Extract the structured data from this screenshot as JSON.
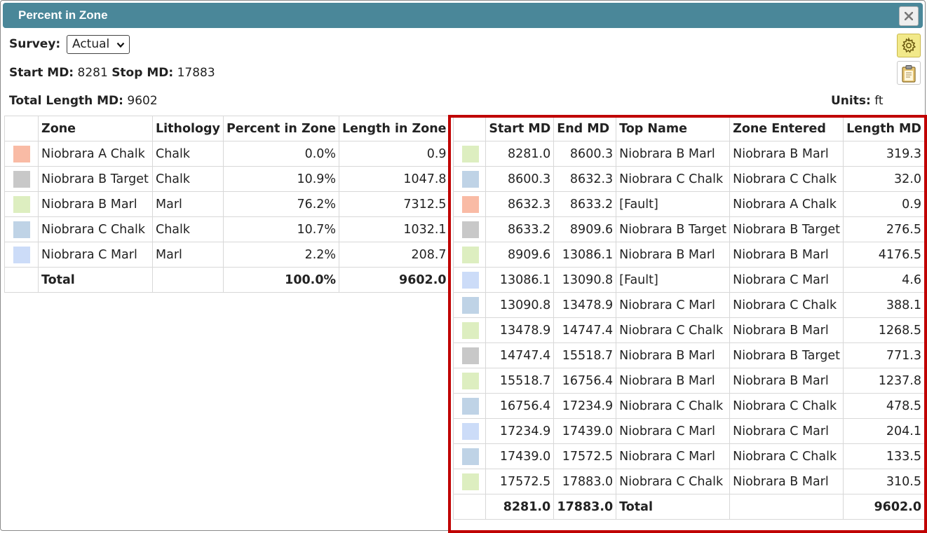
{
  "window": {
    "title": "Percent in Zone"
  },
  "survey": {
    "label": "Survey:",
    "value": "Actual"
  },
  "md_info": {
    "start_label": "Start MD:",
    "start_value": "8281",
    "stop_label": "Stop MD:",
    "stop_value": "17883",
    "total_label": "Total Length MD:",
    "total_value": "9602",
    "units_label": "Units:",
    "units_value": "ft"
  },
  "zone_table": {
    "headers": [
      "Zone",
      "Lithology",
      "Percent in Zone",
      "Length in Zone"
    ],
    "rows": [
      {
        "color": "#f9bba5",
        "zone": "Niobrara A Chalk",
        "lithology": "Chalk",
        "percent": "0.0%",
        "length": "0.9"
      },
      {
        "color": "#c8c8c8",
        "zone": "Niobrara B Target",
        "lithology": "Chalk",
        "percent": "10.9%",
        "length": "1047.8"
      },
      {
        "color": "#ddeec0",
        "zone": "Niobrara B Marl",
        "lithology": "Marl",
        "percent": "76.2%",
        "length": "7312.5"
      },
      {
        "color": "#bfd3e6",
        "zone": "Niobrara C Chalk",
        "lithology": "Chalk",
        "percent": "10.7%",
        "length": "1032.1"
      },
      {
        "color": "#ccdcf8",
        "zone": "Niobrara C Marl",
        "lithology": "Marl",
        "percent": "2.2%",
        "length": "208.7"
      }
    ],
    "total": {
      "label": "Total",
      "percent": "100.0%",
      "length": "9602.0"
    }
  },
  "interval_table": {
    "headers": [
      "Start MD",
      "End MD",
      "Top Name",
      "Zone Entered",
      "Length MD"
    ],
    "rows": [
      {
        "color": "#ddeec0",
        "start": "8281.0",
        "end": "8600.3",
        "top": "Niobrara B Marl",
        "zone": "Niobrara B Marl",
        "length": "319.3"
      },
      {
        "color": "#bfd3e6",
        "start": "8600.3",
        "end": "8632.3",
        "top": "Niobrara C Chalk",
        "zone": "Niobrara C Chalk",
        "length": "32.0"
      },
      {
        "color": "#f9bba5",
        "start": "8632.3",
        "end": "8633.2",
        "top": "[Fault]",
        "zone": "Niobrara A Chalk",
        "length": "0.9"
      },
      {
        "color": "#c8c8c8",
        "start": "8633.2",
        "end": "8909.6",
        "top": "Niobrara B Target",
        "zone": "Niobrara B Target",
        "length": "276.5"
      },
      {
        "color": "#ddeec0",
        "start": "8909.6",
        "end": "13086.1",
        "top": "Niobrara B Marl",
        "zone": "Niobrara B Marl",
        "length": "4176.5"
      },
      {
        "color": "#ccdcf8",
        "start": "13086.1",
        "end": "13090.8",
        "top": "[Fault]",
        "zone": "Niobrara C Marl",
        "length": "4.6"
      },
      {
        "color": "#bfd3e6",
        "start": "13090.8",
        "end": "13478.9",
        "top": "Niobrara C Marl",
        "zone": "Niobrara C Chalk",
        "length": "388.1"
      },
      {
        "color": "#ddeec0",
        "start": "13478.9",
        "end": "14747.4",
        "top": "Niobrara C Chalk",
        "zone": "Niobrara B Marl",
        "length": "1268.5"
      },
      {
        "color": "#c8c8c8",
        "start": "14747.4",
        "end": "15518.7",
        "top": "Niobrara B Marl",
        "zone": "Niobrara B Target",
        "length": "771.3"
      },
      {
        "color": "#ddeec0",
        "start": "15518.7",
        "end": "16756.4",
        "top": "Niobrara B Marl",
        "zone": "Niobrara B Marl",
        "length": "1237.8"
      },
      {
        "color": "#bfd3e6",
        "start": "16756.4",
        "end": "17234.9",
        "top": "Niobrara C Chalk",
        "zone": "Niobrara C Chalk",
        "length": "478.5"
      },
      {
        "color": "#ccdcf8",
        "start": "17234.9",
        "end": "17439.0",
        "top": "Niobrara C Marl",
        "zone": "Niobrara C Marl",
        "length": "204.1"
      },
      {
        "color": "#bfd3e6",
        "start": "17439.0",
        "end": "17572.5",
        "top": "Niobrara C Marl",
        "zone": "Niobrara C Chalk",
        "length": "133.5"
      },
      {
        "color": "#ddeec0",
        "start": "17572.5",
        "end": "17883.0",
        "top": "Niobrara C Chalk",
        "zone": "Niobrara B Marl",
        "length": "310.5"
      }
    ],
    "total": {
      "start": "8281.0",
      "end": "17883.0",
      "label": "Total",
      "length": "9602.0"
    }
  },
  "icons": {
    "close": "close-icon",
    "settings": "gear-icon",
    "clipboard": "clipboard-icon"
  },
  "colors": {
    "titlebar": "#4a8799",
    "highlight": "#c00000",
    "settings_button": "#f2e98a"
  }
}
